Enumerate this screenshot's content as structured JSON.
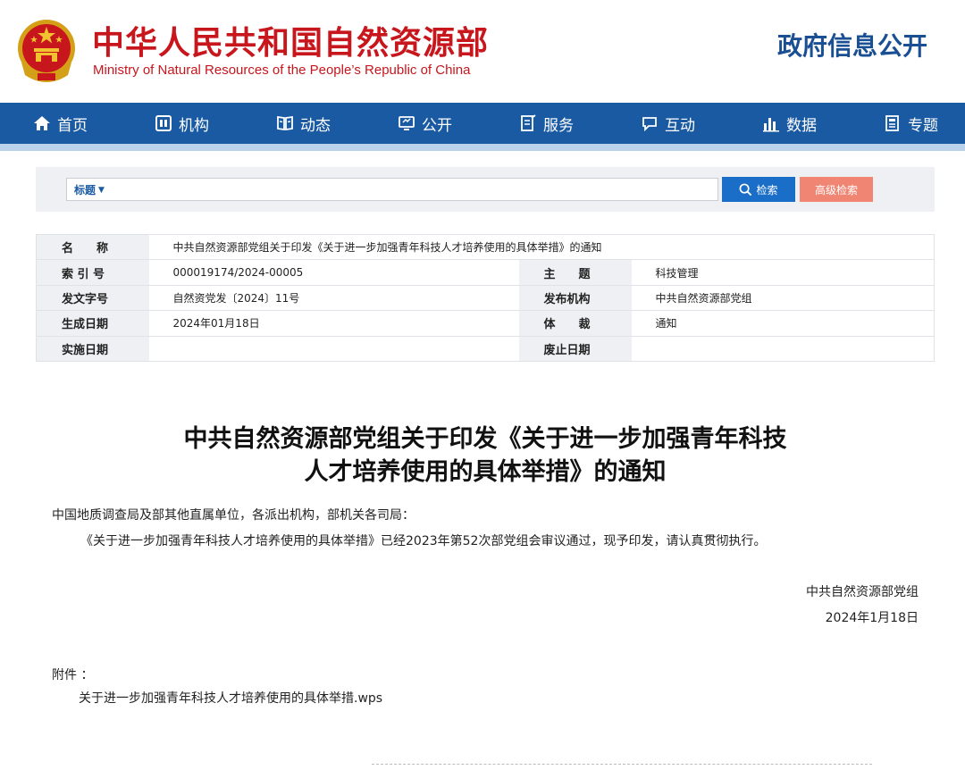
{
  "header": {
    "title_cn": "中华人民共和国自然资源部",
    "title_en": "Ministry of Natural Resources of the People’s Republic of China",
    "section": "政府信息公开",
    "emblem_icon": "national-emblem-icon"
  },
  "nav": {
    "items": [
      {
        "label": "首页",
        "icon": "home-icon"
      },
      {
        "label": "机构",
        "icon": "org-icon"
      },
      {
        "label": "动态",
        "icon": "news-icon"
      },
      {
        "label": "公开",
        "icon": "monitor-icon"
      },
      {
        "label": "服务",
        "icon": "service-icon"
      },
      {
        "label": "互动",
        "icon": "chat-icon"
      },
      {
        "label": "数据",
        "icon": "bar-chart-icon"
      },
      {
        "label": "专题",
        "icon": "topic-icon"
      }
    ]
  },
  "search": {
    "type_label": "标题",
    "value": "",
    "search_label": "检索",
    "advanced_label": "高级检索"
  },
  "info": {
    "name_label": "名　　称",
    "name_value": "中共自然资源部党组关于印发《关于进一步加强青年科技人才培养使用的具体举措》的通知",
    "index_label": "索 引 号",
    "index_value": "000019174/2024-00005",
    "topic_label": "主　　题",
    "topic_value": "科技管理",
    "doc_no_label": "发文字号",
    "doc_no_value": "自然资党发〔2024〕11号",
    "publisher_label": "发布机构",
    "publisher_value": "中共自然资源部党组",
    "created_label": "生成日期",
    "created_value": "2024年01月18日",
    "genre_label": "体　　裁",
    "genre_value": "通知",
    "effective_label": "实施日期",
    "effective_value": "",
    "expiry_label": "废止日期",
    "expiry_value": ""
  },
  "article": {
    "title_line1": "中共自然资源部党组关于印发《关于进一步加强青年科技",
    "title_line2": "人才培养使用的具体举措》的通知",
    "salutation": "中国地质调查局及部其他直属单位，各派出机构，部机关各司局：",
    "body": "《关于进一步加强青年科技人才培养使用的具体举措》已经2023年第52次部党组会审议通过，现予印发，请认真贯彻执行。",
    "signer": "中共自然资源部党组",
    "date": "2024年1月18日",
    "attachment_label": "附件 ：",
    "attachment_file": "关于进一步加强青年科技人才培养使用的具体举措.wps"
  },
  "colors": {
    "brand_red": "#c8161d",
    "nav_blue": "#1a5aa3",
    "search_blue": "#1a6ec8",
    "advanced_salmon": "#f08573"
  }
}
